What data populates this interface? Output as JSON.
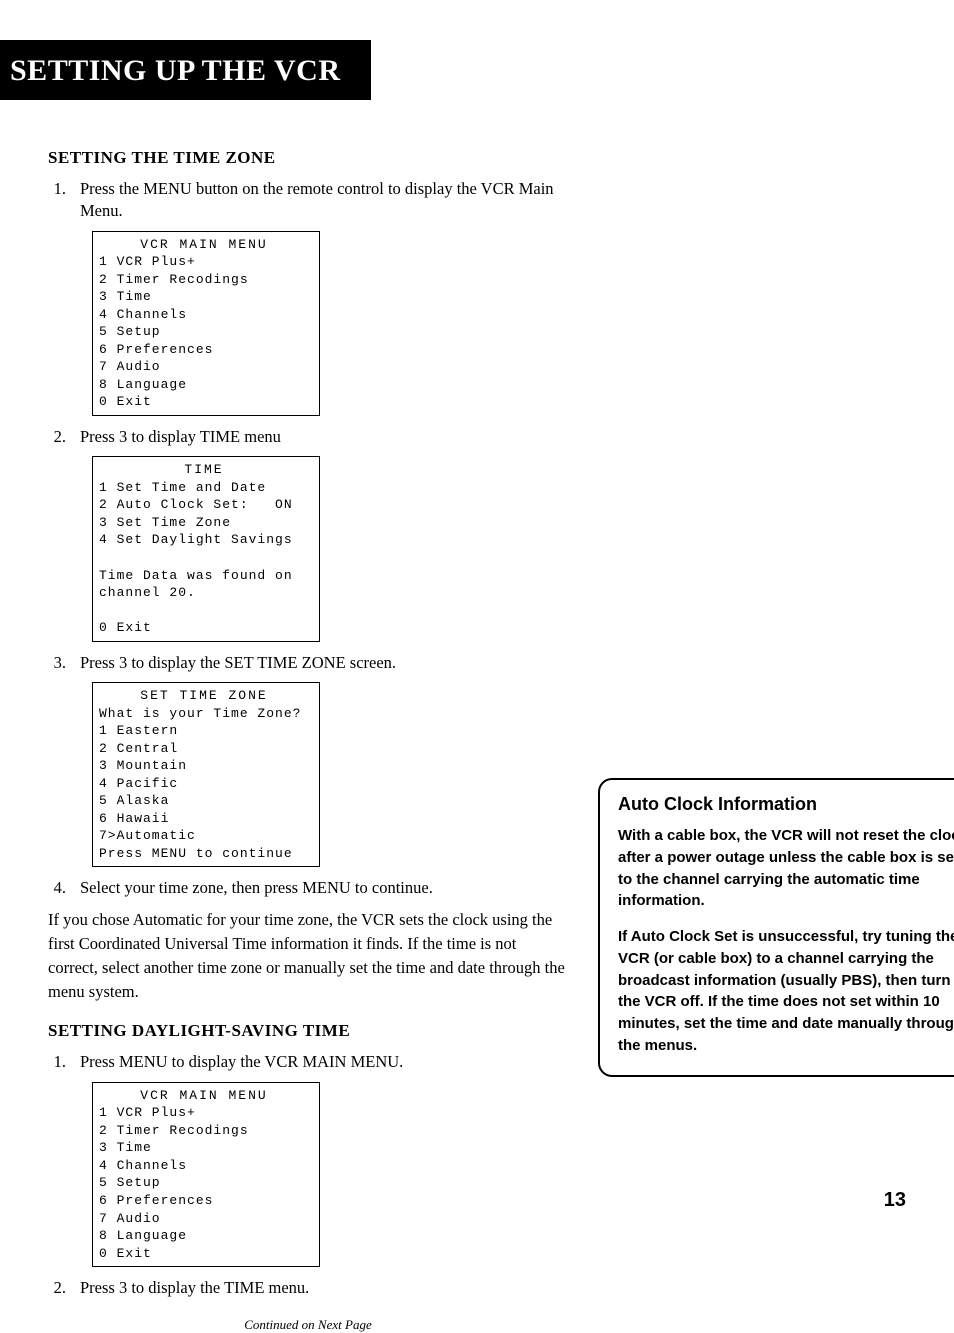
{
  "page_title": "SETTING UP THE VCR",
  "section1": {
    "heading": "SETTING THE TIME ZONE",
    "steps": [
      {
        "n": "1.",
        "t": "Press the MENU button on the remote control to display the VCR Main Menu."
      },
      {
        "n": "2.",
        "t": "Press 3 to display TIME menu"
      },
      {
        "n": "3.",
        "t": "Press 3 to display the SET TIME ZONE screen."
      },
      {
        "n": "4.",
        "t": "Select your time zone, then press MENU to continue."
      }
    ],
    "screen_main_menu": {
      "title": "VCR MAIN MENU",
      "lines": [
        "1 VCR Plus+",
        "2 Timer Recodings",
        "3 Time",
        "4 Channels",
        "5 Setup",
        "6 Preferences",
        "7 Audio",
        "8 Language",
        "0 Exit"
      ]
    },
    "screen_time": {
      "title": "TIME",
      "lines": [
        "1 Set Time and Date",
        "2 Auto Clock Set:   ON",
        "3 Set Time Zone",
        "4 Set Daylight Savings",
        "",
        "Time Data was found on",
        "channel 20.",
        "",
        "0 Exit"
      ]
    },
    "screen_set_tz": {
      "title": "SET TIME ZONE",
      "lines": [
        "What is your Time Zone?",
        "1 Eastern",
        "2 Central",
        "3 Mountain",
        "4 Pacific",
        "5 Alaska",
        "6 Hawaii",
        "7>Automatic",
        "Press MENU to continue"
      ]
    },
    "followup": "If you chose Automatic for your time zone, the VCR sets the clock using the first Coordinated Universal Time information it finds. If the time is not correct, select another time zone or manually set the time and date through the menu system."
  },
  "section2": {
    "heading": "SETTING DAYLIGHT-SAVING TIME",
    "steps": [
      {
        "n": "1.",
        "t": "Press MENU to display the VCR MAIN MENU."
      },
      {
        "n": "2.",
        "t": "Press 3 to display the TIME menu."
      }
    ],
    "screen_main_menu": {
      "title": "VCR MAIN MENU",
      "lines": [
        "1 VCR Plus+",
        "2 Timer Recodings",
        "3 Time",
        "4 Channels",
        "5 Setup",
        "6 Preferences",
        "7 Audio",
        "8 Language",
        "0 Exit"
      ]
    }
  },
  "sidebar": {
    "title": "Auto Clock Information",
    "p1": "With a cable box, the VCR will not reset the clock after a power outage unless the cable box is set to the channel carrying the automatic time information.",
    "p2": "If Auto Clock Set is unsuccessful, try tuning the VCR (or cable box) to a channel carrying the broadcast information (usually PBS), then turn the VCR off. If the time does not set within 10 minutes, set the time and date manually through the menus."
  },
  "continued": "Continued on Next Page",
  "page_number": "13"
}
